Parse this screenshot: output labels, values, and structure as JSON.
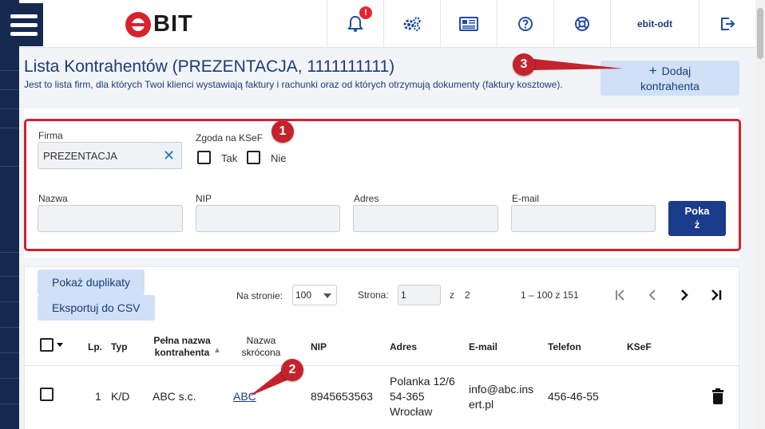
{
  "header": {
    "logo_text": "BIT",
    "notifications_badge": "!",
    "user": "ebit-odt",
    "icons": [
      "bell-icon",
      "gears-icon",
      "newspaper-icon",
      "help-icon",
      "lifebuoy-icon",
      "logout-icon"
    ]
  },
  "page": {
    "title": "Lista Kontrahentów (PREZENTACJA, 1111111111)",
    "subtitle": "Jest to lista firm, dla których Twoi klienci wystawiają faktury i rachunki oraz od których otrzymują dokumenty (faktury kosztowe).",
    "add_button_line1": "Dodaj",
    "add_button_line2": "kontrahenta"
  },
  "filters": {
    "firma_label": "Firma",
    "firma_value": "PREZENTACJA",
    "ksef_label": "Zgoda na KSeF",
    "tak_label": "Tak",
    "nie_label": "Nie",
    "nazwa_label": "Nazwa",
    "nip_label": "NIP",
    "adres_label": "Adres",
    "email_label": "E-mail",
    "show_line1": "Poka",
    "show_line2": "ż"
  },
  "toolbar": {
    "duplicates_label": "Pokaż duplikaty",
    "export_label": "Eksportuj do CSV",
    "per_page_label": "Na stronie:",
    "per_page_value": "100",
    "page_label": "Strona:",
    "page_value": "1",
    "of_label": "z",
    "total_pages": "2",
    "range": "1 – 100 z 151"
  },
  "table": {
    "headers": {
      "lp": "Lp.",
      "typ": "Typ",
      "full_name_1": "Pełna nazwa",
      "full_name_2": "kontrahenta",
      "short_name_1": "Nazwa",
      "short_name_2": "skrócona",
      "nip": "NIP",
      "adres": "Adres",
      "email": "E-mail",
      "telefon": "Telefon",
      "ksef": "KSeF"
    },
    "rows": [
      {
        "lp": "1",
        "typ": "K/D",
        "full_name": "ABC s.c.",
        "short_name": "ABC",
        "nip": "8945653563",
        "adres_1": "Polanka 12/6",
        "adres_2": "54-365",
        "adres_3": "Wrocław",
        "email_1": "info@abc.ins",
        "email_2": "ert.pl",
        "telefon": "456-46-55"
      }
    ]
  },
  "markers": [
    "1",
    "2",
    "3"
  ],
  "colors": {
    "navy": "#16294f",
    "accent_blue": "#1b3b8b",
    "light_button": "#cfe0f7",
    "marker_red": "#c4232d"
  }
}
